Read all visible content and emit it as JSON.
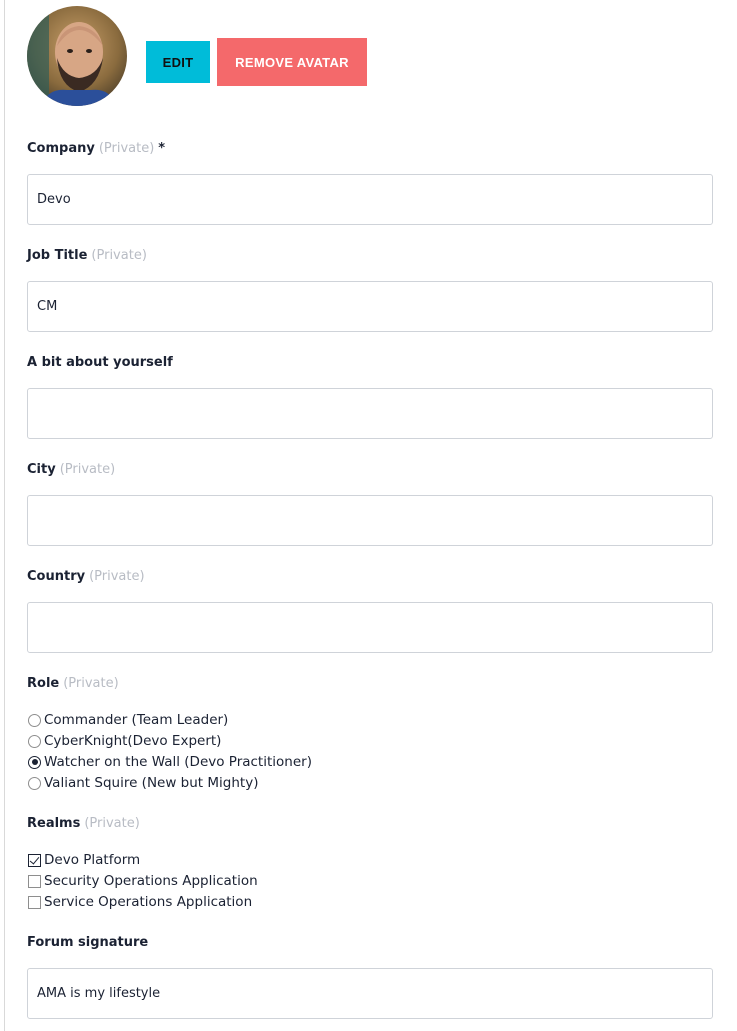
{
  "avatar": {
    "edit_label": "EDIT",
    "remove_label": "REMOVE AVATAR"
  },
  "fields": {
    "company": {
      "label": "Company",
      "private": "(Private)",
      "required": "*",
      "value": "Devo"
    },
    "job_title": {
      "label": "Job Title",
      "private": "(Private)",
      "value": "CM"
    },
    "about": {
      "label": "A bit about yourself",
      "value": ""
    },
    "city": {
      "label": "City",
      "private": "(Private)",
      "value": ""
    },
    "country": {
      "label": "Country",
      "private": "(Private)",
      "value": ""
    },
    "forum_signature": {
      "label": "Forum signature",
      "value": "AMA is my lifestyle"
    }
  },
  "role": {
    "label": "Role",
    "private": "(Private)",
    "options": [
      {
        "label": "Commander (Team Leader)",
        "selected": false
      },
      {
        "label": "CyberKnight(Devo Expert)",
        "selected": false
      },
      {
        "label": "Watcher on the Wall (Devo Practitioner)",
        "selected": true
      },
      {
        "label": "Valiant Squire (New but Mighty)",
        "selected": false
      }
    ]
  },
  "realms": {
    "label": "Realms",
    "private": "(Private)",
    "options": [
      {
        "label": "Devo Platform",
        "checked": true
      },
      {
        "label": "Security Operations Application",
        "checked": false
      },
      {
        "label": "Service Operations Application",
        "checked": false
      }
    ]
  },
  "colors": {
    "edit_button": "#00bcd9",
    "remove_button": "#f4696b",
    "text": "#1b2233",
    "private_text": "#b8bcc4"
  }
}
